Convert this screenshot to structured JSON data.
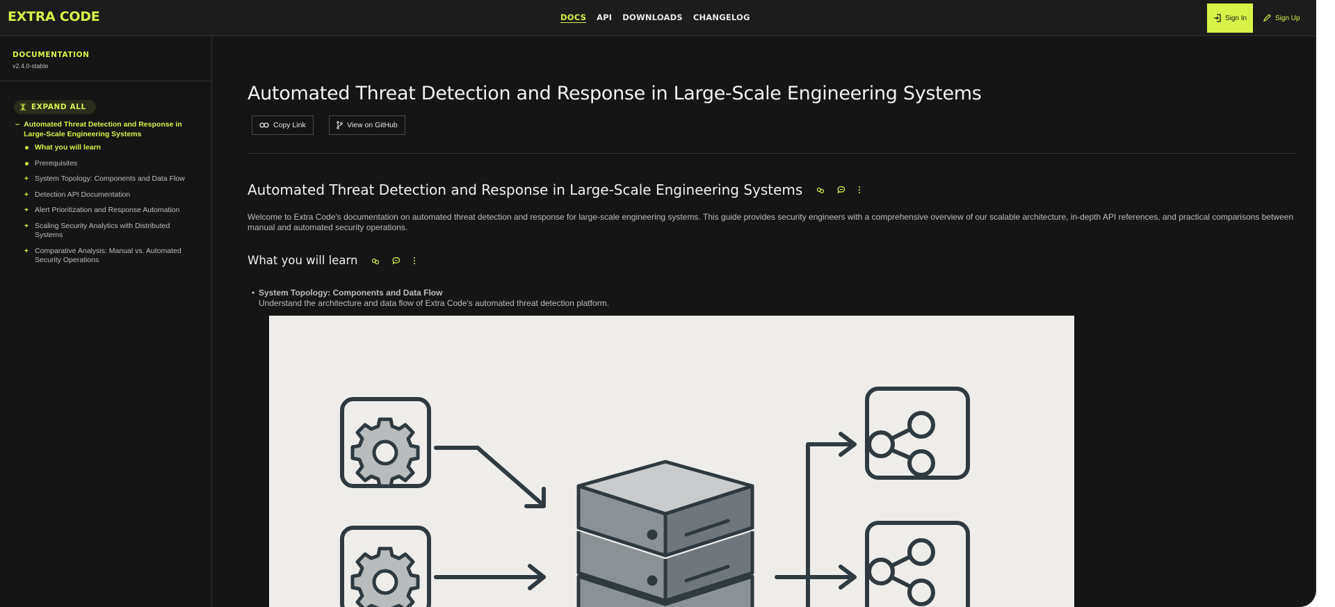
{
  "brand": {
    "logo": "EXTRA CODE"
  },
  "nav": {
    "items": [
      "DOCS",
      "API",
      "DOWNLOADS",
      "CHANGELOG"
    ]
  },
  "auth": {
    "sign_in": "Sign In",
    "sign_up": "Sign Up"
  },
  "sidebar": {
    "title": "DOCUMENTATION",
    "version": "v2.4.0-stable",
    "expand_all": "EXPAND ALL",
    "root": "Automated Threat Detection and Response in Large-Scale Engineering Systems",
    "items": [
      {
        "label": "What you will learn",
        "marker": "dot",
        "active": true
      },
      {
        "label": "Prerequisites",
        "marker": "dot"
      },
      {
        "label": "System Topology: Components and Data Flow",
        "marker": "+"
      },
      {
        "label": "Detection API Documentation",
        "marker": "+"
      },
      {
        "label": "Alert Prioritization and Response Automation",
        "marker": "+"
      },
      {
        "label": "Scaling Security Analytics with Distributed Systems",
        "marker": "+"
      },
      {
        "label": "Comparative Analysis: Manual vs. Automated Security Operations",
        "marker": "+"
      }
    ]
  },
  "main": {
    "title": "Automated Threat Detection and Response in Large-Scale Engineering Systems",
    "copy_link": "Copy Link",
    "view_github": "View on GitHub",
    "section_title": "Automated Threat Detection and Response in Large-Scale Engineering Systems",
    "intro": "Welcome to Extra Code's documentation on automated threat detection and response for large-scale engineering systems. This guide provides security engineers with a comprehensive overview of our scalable architecture, in-depth API references, and practical comparisons between manual and automated security operations.",
    "learn_title": "What you will learn",
    "bullet_title": "System Topology: Components and Data Flow",
    "bullet_desc": "Understand the architecture and data flow of Extra Code's automated threat detection platform.",
    "figure_icons": [
      "gear-icon",
      "gear-icon",
      "arrow-right-icon",
      "database-server-icon",
      "share-icon",
      "share-icon"
    ]
  },
  "colors": {
    "accent": "#d8f24a",
    "background": "#151515",
    "text_muted": "#bdbdbd"
  }
}
